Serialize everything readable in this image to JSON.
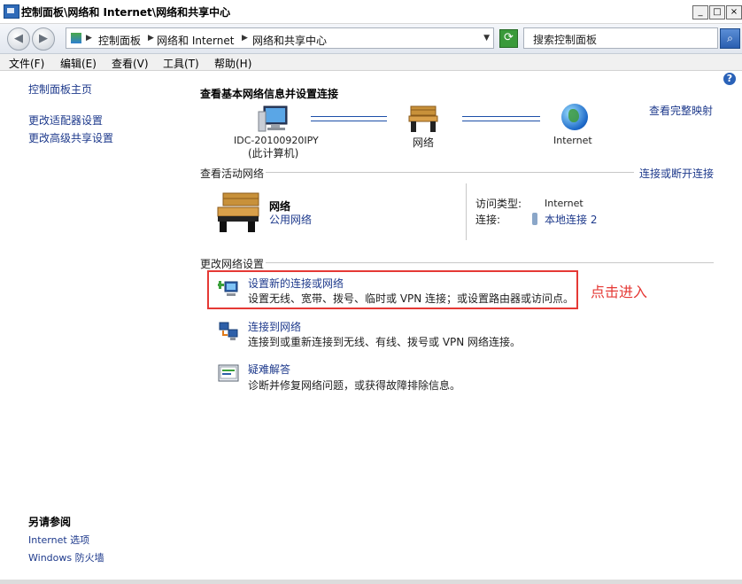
{
  "window": {
    "title": "控制面板\\网络和 Internet\\网络和共享中心"
  },
  "address": {
    "breadcrumbs": [
      "控制面板",
      "网络和 Internet",
      "网络和共享中心"
    ],
    "search_placeholder": "搜索控制面板"
  },
  "menu": [
    "文件(F)",
    "编辑(E)",
    "查看(V)",
    "工具(T)",
    "帮助(H)"
  ],
  "sidebar": {
    "links": [
      "控制面板主页",
      "更改适配器设置",
      "更改高级共享设置"
    ],
    "see_also_title": "另请参阅",
    "see_also": [
      "Internet 选项",
      "Windows 防火墙"
    ]
  },
  "main": {
    "title": "查看基本网络信息并设置连接",
    "full_map_link": "查看完整映射",
    "map": {
      "computer_name": "IDC-20100920IPY",
      "computer_sub": "(此计算机)",
      "network_label": "网络",
      "internet_label": "Internet"
    },
    "active": {
      "section_title": "查看活动网络",
      "connect_link": "连接或断开连接",
      "network_name": "网络",
      "network_type": "公用网络",
      "access_label": "访问类型:",
      "access_value": "Internet",
      "conn_label": "连接:",
      "conn_value": "本地连接 2"
    },
    "change": {
      "section_title": "更改网络设置",
      "tasks": [
        {
          "title": "设置新的连接或网络",
          "desc": "设置无线、宽带、拨号、临时或 VPN 连接；或设置路由器或访问点。"
        },
        {
          "title": "连接到网络",
          "desc": "连接到或重新连接到无线、有线、拨号或 VPN 网络连接。"
        },
        {
          "title": "疑难解答",
          "desc": "诊断并修复网络问题，或获得故障排除信息。"
        }
      ]
    }
  },
  "annotation": {
    "text": "点击进入",
    "color": "#e53935"
  },
  "icons": {
    "title": "network-center-icon",
    "back": "back-arrow-icon",
    "forward": "forward-arrow-icon",
    "refresh": "refresh-icon",
    "search": "search-icon",
    "help": "help-icon"
  }
}
